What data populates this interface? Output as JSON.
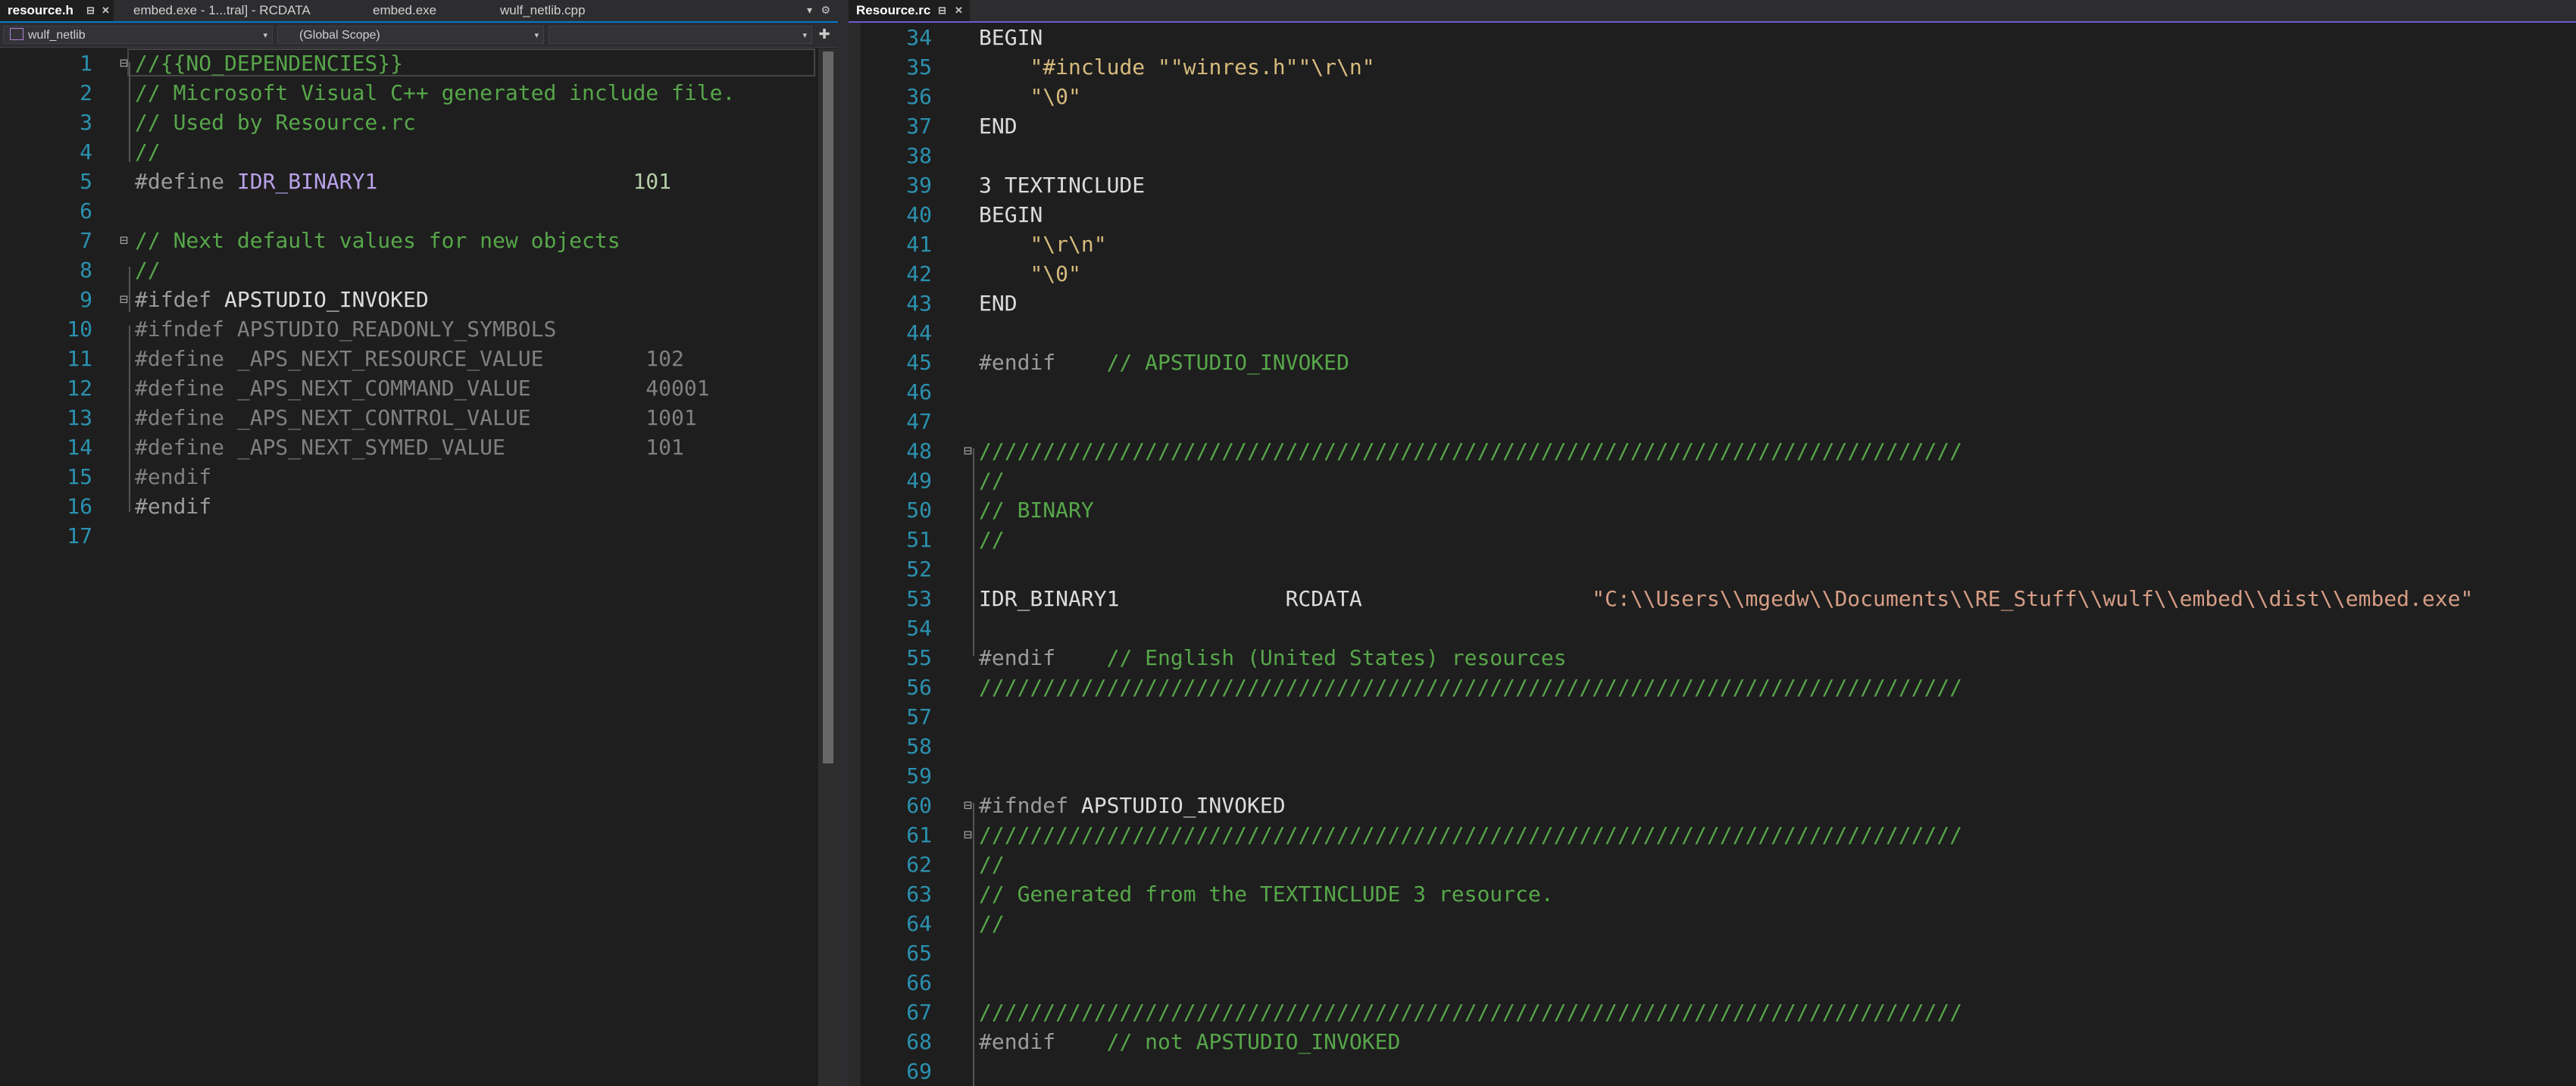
{
  "left_editor": {
    "tabs": [
      {
        "label": "resource.h",
        "active": true
      },
      {
        "label": "embed.exe - 1...tral] - RCDATA",
        "active": false
      },
      {
        "label": "embed.exe",
        "active": false
      },
      {
        "label": "wulf_netlib.cpp",
        "active": false
      }
    ],
    "tab_pin_icon": "⊟",
    "tab_close_icon": "✕",
    "overflow_icon": "▾",
    "settings_icon": "⚙",
    "project_combo": "wulf_netlib",
    "scope_combo": "(Global Scope)",
    "member_combo": "",
    "dropdown_icon": "▾",
    "split_icon": "✚",
    "lines": [
      {
        "n": "1",
        "fold": "⊟",
        "parts": [
          {
            "t": "//{{NO_DEPENDENCIES}}",
            "c": "c-green"
          }
        ]
      },
      {
        "n": "2",
        "fold": "",
        "parts": [
          {
            "t": "// Microsoft Visual C++ generated include file.",
            "c": "c-green"
          }
        ]
      },
      {
        "n": "3",
        "fold": "",
        "parts": [
          {
            "t": "// Used by Resource.rc",
            "c": "c-green"
          }
        ]
      },
      {
        "n": "4",
        "fold": "",
        "parts": [
          {
            "t": "//",
            "c": "c-green"
          }
        ]
      },
      {
        "n": "5",
        "fold": "",
        "parts": [
          {
            "t": "#define ",
            "c": "c-pre"
          },
          {
            "t": "IDR_BINARY1",
            "c": "c-purple"
          },
          {
            "t": "                    101",
            "c": "c-num"
          }
        ]
      },
      {
        "n": "6",
        "fold": "",
        "parts": []
      },
      {
        "n": "7",
        "fold": "⊟",
        "parts": [
          {
            "t": "// Next default values for new objects",
            "c": "c-green"
          }
        ]
      },
      {
        "n": "8",
        "fold": "",
        "parts": [
          {
            "t": "//",
            "c": "c-green"
          }
        ]
      },
      {
        "n": "9",
        "fold": "⊟",
        "parts": [
          {
            "t": "#ifdef ",
            "c": "c-pre"
          },
          {
            "t": "APSTUDIO_INVOKED",
            "c": "c-plain"
          }
        ]
      },
      {
        "n": "10",
        "fold": "",
        "parts": [
          {
            "t": "#ifndef APSTUDIO_READONLY_SYMBOLS",
            "c": "c-dim"
          }
        ]
      },
      {
        "n": "11",
        "fold": "",
        "parts": [
          {
            "t": "#define _APS_NEXT_RESOURCE_VALUE        102",
            "c": "c-dim"
          }
        ]
      },
      {
        "n": "12",
        "fold": "",
        "parts": [
          {
            "t": "#define _APS_NEXT_COMMAND_VALUE         40001",
            "c": "c-dim"
          }
        ]
      },
      {
        "n": "13",
        "fold": "",
        "parts": [
          {
            "t": "#define _APS_NEXT_CONTROL_VALUE         1001",
            "c": "c-dim"
          }
        ]
      },
      {
        "n": "14",
        "fold": "",
        "parts": [
          {
            "t": "#define _APS_NEXT_SYMED_VALUE           101",
            "c": "c-dim"
          }
        ]
      },
      {
        "n": "15",
        "fold": "",
        "parts": [
          {
            "t": "#endif",
            "c": "c-dim"
          }
        ]
      },
      {
        "n": "16",
        "fold": "",
        "parts": [
          {
            "t": "#endif",
            "c": "c-pre"
          }
        ]
      },
      {
        "n": "17",
        "fold": "",
        "parts": []
      }
    ]
  },
  "right_editor": {
    "tabs": [
      {
        "label": "Resource.rc",
        "active": true
      }
    ],
    "tab_pin_icon": "⊟",
    "tab_close_icon": "✕",
    "lines": [
      {
        "n": "34",
        "fold": "",
        "parts": [
          {
            "t": "BEGIN",
            "c": "c-plain"
          }
        ]
      },
      {
        "n": "35",
        "fold": "",
        "parts": [
          {
            "t": "    ",
            "c": "c-plain"
          },
          {
            "t": "\"#include \"\"winres.h\"\"\\r\\n\"",
            "c": "c-yellow"
          }
        ]
      },
      {
        "n": "36",
        "fold": "",
        "parts": [
          {
            "t": "    ",
            "c": "c-plain"
          },
          {
            "t": "\"\\0\"",
            "c": "c-yellow"
          }
        ]
      },
      {
        "n": "37",
        "fold": "",
        "parts": [
          {
            "t": "END",
            "c": "c-plain"
          }
        ]
      },
      {
        "n": "38",
        "fold": "",
        "parts": []
      },
      {
        "n": "39",
        "fold": "",
        "parts": [
          {
            "t": "3 TEXTINCLUDE",
            "c": "c-plain"
          }
        ]
      },
      {
        "n": "40",
        "fold": "",
        "parts": [
          {
            "t": "BEGIN",
            "c": "c-plain"
          }
        ]
      },
      {
        "n": "41",
        "fold": "",
        "parts": [
          {
            "t": "    ",
            "c": "c-plain"
          },
          {
            "t": "\"\\r\\n\"",
            "c": "c-yellow"
          }
        ]
      },
      {
        "n": "42",
        "fold": "",
        "parts": [
          {
            "t": "    ",
            "c": "c-plain"
          },
          {
            "t": "\"\\0\"",
            "c": "c-yellow"
          }
        ]
      },
      {
        "n": "43",
        "fold": "",
        "parts": [
          {
            "t": "END",
            "c": "c-plain"
          }
        ]
      },
      {
        "n": "44",
        "fold": "",
        "parts": []
      },
      {
        "n": "45",
        "fold": "",
        "parts": [
          {
            "t": "#endif",
            "c": "c-pre"
          },
          {
            "t": "    // APSTUDIO_INVOKED",
            "c": "c-green"
          }
        ]
      },
      {
        "n": "46",
        "fold": "",
        "parts": []
      },
      {
        "n": "47",
        "fold": "",
        "parts": []
      },
      {
        "n": "48",
        "fold": "⊟",
        "parts": [
          {
            "t": "/////////////////////////////////////////////////////////////////////////////",
            "c": "c-green"
          }
        ]
      },
      {
        "n": "49",
        "fold": "",
        "parts": [
          {
            "t": "//",
            "c": "c-green"
          }
        ]
      },
      {
        "n": "50",
        "fold": "",
        "parts": [
          {
            "t": "// BINARY",
            "c": "c-green"
          }
        ]
      },
      {
        "n": "51",
        "fold": "",
        "parts": [
          {
            "t": "//",
            "c": "c-green"
          }
        ]
      },
      {
        "n": "52",
        "fold": "",
        "parts": []
      },
      {
        "n": "53",
        "fold": "",
        "parts": [
          {
            "t": "IDR_BINARY1             RCDATA                  ",
            "c": "c-plain"
          },
          {
            "t": "\"C:\\\\Users\\\\mgedw\\\\Documents\\\\RE_Stuff\\\\wulf\\\\embed\\\\dist\\\\embed.exe\"",
            "c": "c-str"
          }
        ]
      },
      {
        "n": "54",
        "fold": "",
        "parts": []
      },
      {
        "n": "55",
        "fold": "",
        "parts": [
          {
            "t": "#endif",
            "c": "c-pre"
          },
          {
            "t": "    // English (United States) resources",
            "c": "c-green"
          }
        ]
      },
      {
        "n": "56",
        "fold": "",
        "parts": [
          {
            "t": "/////////////////////////////////////////////////////////////////////////////",
            "c": "c-green"
          }
        ]
      },
      {
        "n": "57",
        "fold": "",
        "parts": []
      },
      {
        "n": "58",
        "fold": "",
        "parts": []
      },
      {
        "n": "59",
        "fold": "",
        "parts": []
      },
      {
        "n": "60",
        "fold": "⊟",
        "parts": [
          {
            "t": "#ifndef ",
            "c": "c-pre"
          },
          {
            "t": "APSTUDIO_INVOKED",
            "c": "c-plain"
          }
        ]
      },
      {
        "n": "61",
        "fold": "⊟",
        "parts": [
          {
            "t": "/////////////////////////////////////////////////////////////////////////////",
            "c": "c-green"
          }
        ]
      },
      {
        "n": "62",
        "fold": "",
        "parts": [
          {
            "t": "//",
            "c": "c-green"
          }
        ]
      },
      {
        "n": "63",
        "fold": "",
        "parts": [
          {
            "t": "// Generated from the TEXTINCLUDE 3 resource.",
            "c": "c-green"
          }
        ]
      },
      {
        "n": "64",
        "fold": "",
        "parts": [
          {
            "t": "//",
            "c": "c-green"
          }
        ]
      },
      {
        "n": "65",
        "fold": "",
        "parts": []
      },
      {
        "n": "66",
        "fold": "",
        "parts": []
      },
      {
        "n": "67",
        "fold": "",
        "parts": [
          {
            "t": "/////////////////////////////////////////////////////////////////////////////",
            "c": "c-green"
          }
        ]
      },
      {
        "n": "68",
        "fold": "",
        "parts": [
          {
            "t": "#endif",
            "c": "c-pre"
          },
          {
            "t": "    // not APSTUDIO_INVOKED",
            "c": "c-green"
          }
        ]
      },
      {
        "n": "69",
        "fold": "",
        "parts": []
      }
    ]
  }
}
